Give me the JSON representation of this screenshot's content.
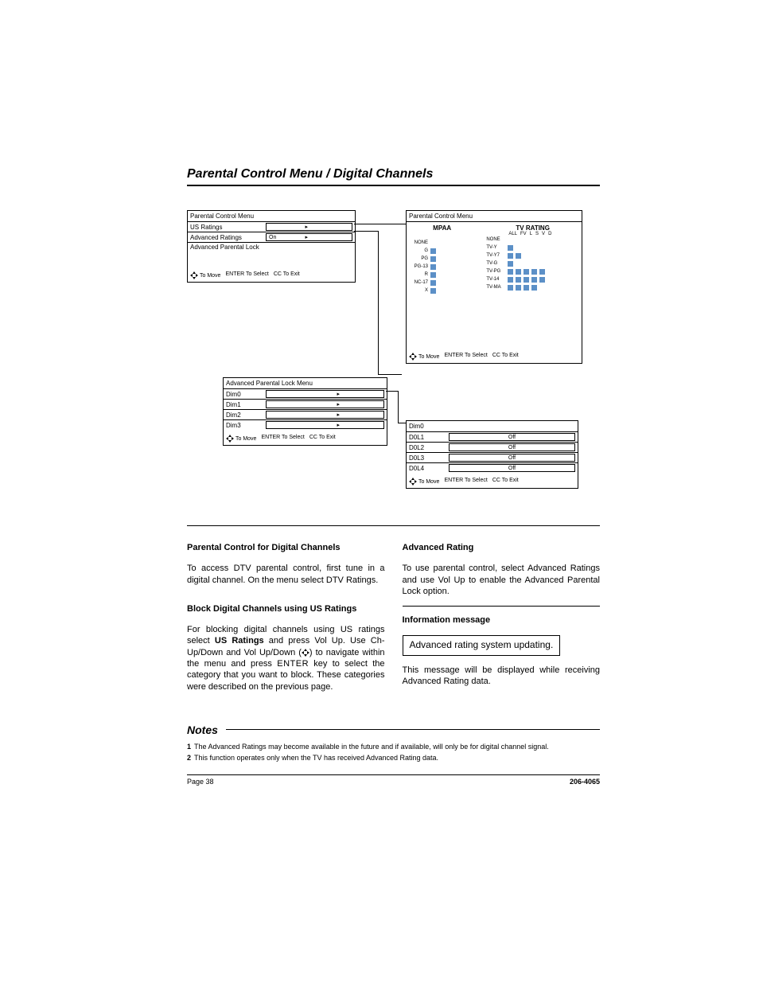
{
  "title": "Parental Control Menu / Digital Channels",
  "panel1": {
    "title": "Parental Control Menu",
    "row1": "US Ratings",
    "row2": "Advanced Ratings",
    "row2_val": "On",
    "row3": "Advanced Parental Lock",
    "hint_move": "To Move",
    "hint_enter": "ENTER To Select",
    "hint_cc": "CC To Exit"
  },
  "panel2": {
    "title": "Parental Control Menu",
    "mpaa_hdr": "MPAA",
    "tv_hdr": "TV RATING",
    "tv_cols": [
      "ALL",
      "FV",
      "L",
      "S",
      "V",
      "D"
    ],
    "mpaa": [
      "NONE",
      "G",
      "PG",
      "PG-13",
      "R",
      "NC-17",
      "X"
    ],
    "tv": [
      "NONE",
      "TV-Y",
      "TV-Y7",
      "TV-G",
      "TV-PG",
      "TV-14",
      "TV-MA"
    ],
    "hint_move": "To Move",
    "hint_enter": "ENTER To Select",
    "hint_cc": "CC To Exit"
  },
  "panel3": {
    "title": "Advanced Parental Lock Menu",
    "rows": [
      "Dim0",
      "Dim1",
      "Dim2",
      "Dim3"
    ],
    "hint_move": "To Move",
    "hint_enter": "ENTER To Select",
    "hint_cc": "CC To Exit"
  },
  "panel4": {
    "title": "Dim0",
    "rows": [
      "D0L1",
      "D0L2",
      "D0L3",
      "D0L4"
    ],
    "val": "Off",
    "hint_move": "To Move",
    "hint_enter": "ENTER To Select",
    "hint_cc": "CC To Exit"
  },
  "text": {
    "left": {
      "h1": "Parental Control for Digital Channels",
      "p1": "To access DTV parental control, first tune in a digital channel. On the menu select DTV Ratings.",
      "h2": "Block Digital Channels using US Ratings",
      "p2a": "For blocking digital channels using US ratings select ",
      "p2b": "US Ratings",
      "p2c": " and press Vol Up. Use Ch-Up/Down and Vol Up/Down (",
      "p2d": ") to navigate within the menu and press ",
      "p2e": "ENTER",
      "p2f": " key to select the category that you want to block. These categories were described on the previous page."
    },
    "right": {
      "h1": "Advanced Rating",
      "p1": "To use parental control, select Advanced Ratings and use Vol Up to enable the Advanced Parental Lock option.",
      "h2": "Information message",
      "box": "Advanced rating system updating.",
      "p2": "This message will be displayed while receiving Advanced Rating data."
    }
  },
  "notes": {
    "title": "Notes",
    "items": [
      "The Advanced Ratings may become available in the future and if available, will only be for digital channel signal.",
      "This function operates only when the TV has received Advanced Rating data."
    ]
  },
  "footer": {
    "left": "Page 38",
    "right": "206-4065"
  }
}
